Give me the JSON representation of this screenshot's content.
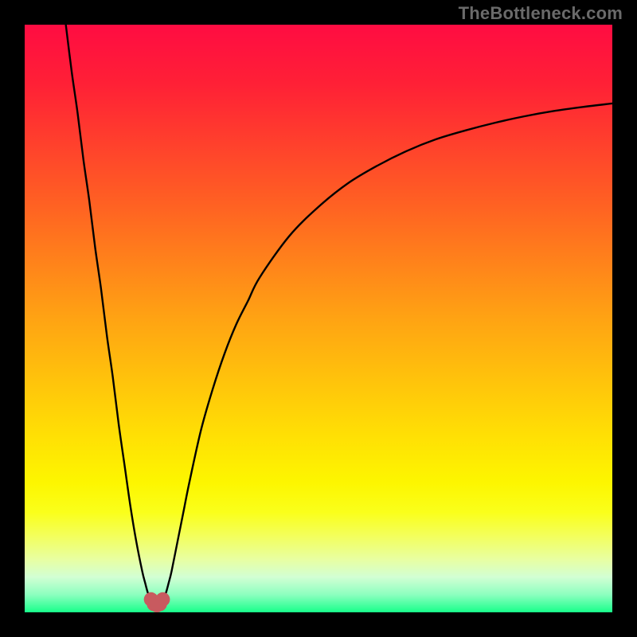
{
  "attribution": "TheBottleneck.com",
  "colors": {
    "frame": "#000000",
    "gradient_stops": [
      {
        "offset": 0.0,
        "color": "#ff0c42"
      },
      {
        "offset": 0.1,
        "color": "#ff2036"
      },
      {
        "offset": 0.3,
        "color": "#ff5f23"
      },
      {
        "offset": 0.5,
        "color": "#ffa313"
      },
      {
        "offset": 0.7,
        "color": "#ffe004"
      },
      {
        "offset": 0.78,
        "color": "#fdf600"
      },
      {
        "offset": 0.83,
        "color": "#faff1b"
      },
      {
        "offset": 0.87,
        "color": "#f3ff5c"
      },
      {
        "offset": 0.91,
        "color": "#e8ffa2"
      },
      {
        "offset": 0.94,
        "color": "#d2ffd4"
      },
      {
        "offset": 0.97,
        "color": "#8cffbf"
      },
      {
        "offset": 1.0,
        "color": "#18ff8a"
      }
    ],
    "curve_stroke": "#000000",
    "marker_fill": "#c85a5f"
  },
  "chart_data": {
    "type": "line",
    "title": "",
    "xlabel": "",
    "ylabel": "",
    "xlim": [
      0,
      100
    ],
    "ylim": [
      0,
      100
    ],
    "grid": false,
    "series": [
      {
        "name": "left-branch",
        "x": [
          7,
          8,
          9,
          10,
          11,
          12,
          13,
          14,
          15,
          16,
          17,
          18,
          19,
          20,
          20.5,
          21,
          21.5
        ],
        "y": [
          100,
          92,
          85,
          77,
          70,
          62,
          55,
          47,
          40,
          32,
          25,
          18,
          12,
          7,
          5,
          3.2,
          2.2
        ]
      },
      {
        "name": "right-branch",
        "x": [
          23.5,
          24,
          24.5,
          25,
          26,
          27,
          28,
          30,
          32,
          34,
          36,
          38,
          40,
          45,
          50,
          55,
          60,
          65,
          70,
          75,
          80,
          85,
          90,
          95,
          100
        ],
        "y": [
          2.2,
          3.2,
          5,
          7,
          12,
          17,
          22,
          31,
          38,
          44,
          49,
          53,
          57,
          64,
          69,
          73,
          76,
          78.5,
          80.5,
          82,
          83.3,
          84.4,
          85.3,
          86,
          86.6
        ]
      },
      {
        "name": "cusp-markers",
        "x": [
          21.5,
          22,
          22.5,
          23,
          23.5
        ],
        "y": [
          2.2,
          1.4,
          1.2,
          1.4,
          2.2
        ]
      }
    ],
    "annotations": []
  }
}
